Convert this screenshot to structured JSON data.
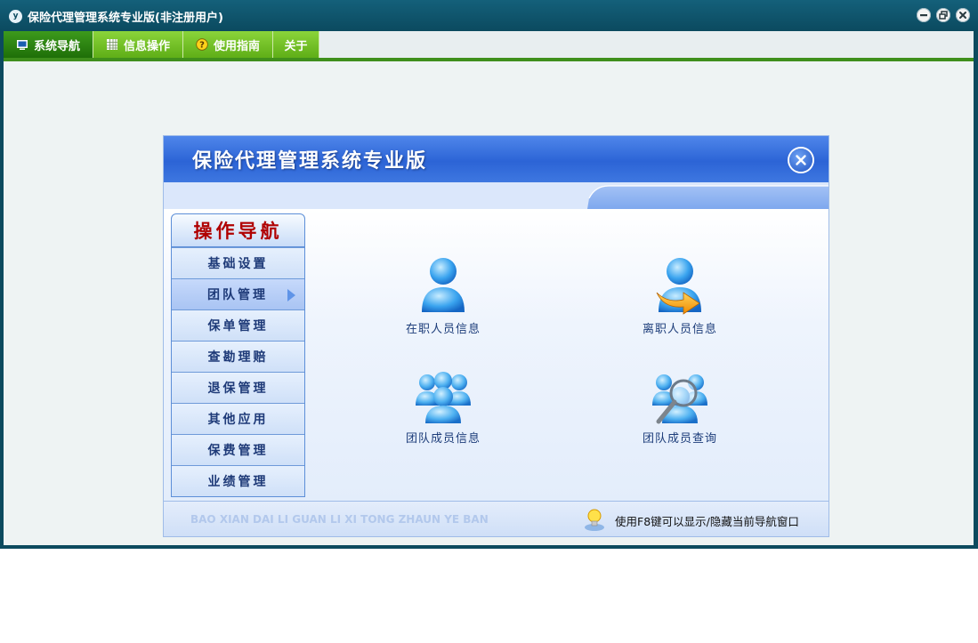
{
  "window": {
    "logo": "y",
    "title": "保险代理管理系统专业版(非注册用户)",
    "controls": [
      "minimize-icon",
      "restore-icon",
      "close-icon"
    ]
  },
  "menu": {
    "items": [
      {
        "label": "系统导航",
        "icon": "monitor-icon",
        "active": true
      },
      {
        "label": "信息操作",
        "icon": "grid-icon",
        "active": false
      },
      {
        "label": "使用指南",
        "icon": "help-icon",
        "active": false
      },
      {
        "label": "关于",
        "icon": "",
        "active": false
      }
    ]
  },
  "panel": {
    "title": "保险代理管理系统专业版",
    "nav_title": "操作导航",
    "nav_items": [
      {
        "label": "基础设置",
        "active": false
      },
      {
        "label": "团队管理",
        "active": true
      },
      {
        "label": "保单管理",
        "active": false
      },
      {
        "label": "查勘理赔",
        "active": false
      },
      {
        "label": "退保管理",
        "active": false
      },
      {
        "label": "其他应用",
        "active": false
      },
      {
        "label": "保费管理",
        "active": false
      },
      {
        "label": "业绩管理",
        "active": false
      }
    ],
    "tiles": [
      {
        "label": "在职人员信息",
        "icon": "user-icon"
      },
      {
        "label": "离职人员信息",
        "icon": "user-leave-icon"
      },
      {
        "label": "团队成员信息",
        "icon": "team-icon"
      },
      {
        "label": "团队成员查询",
        "icon": "team-search-icon"
      }
    ],
    "footer_pinyin": "BAO XIAN DAI LI GUAN LI XI TONG ZHAUN YE BAN",
    "footer_tip": "使用F8键可以显示/隐藏当前导航窗口"
  },
  "colors": {
    "titlebar": "#0b4a5f",
    "menu_green": "#5fae17",
    "menu_active": "#1f6f08",
    "panel_blue": "#2c64d6",
    "nav_title_red": "#b00000"
  }
}
